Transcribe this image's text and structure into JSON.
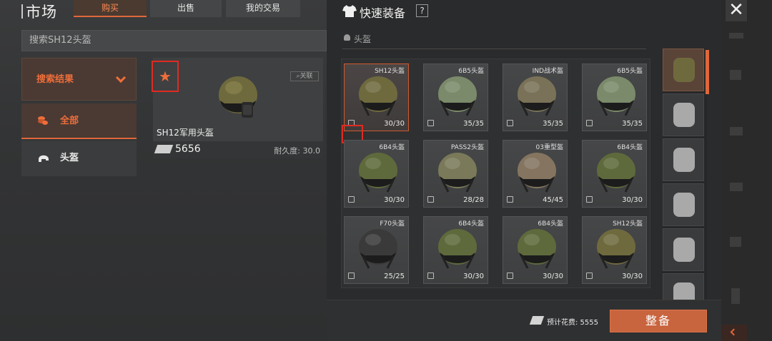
{
  "market": {
    "title": "市场",
    "tabs": [
      {
        "label": "购买",
        "active": true
      },
      {
        "label": "出售",
        "active": false
      },
      {
        "label": "我的交易",
        "active": false
      }
    ],
    "search_placeholder": "搜索SH12头盔",
    "filters": [
      {
        "label": "搜索结果",
        "icon": "chevron-down-icon",
        "selected": true
      },
      {
        "label": "全部",
        "icon": "coins-icon",
        "selected": true
      },
      {
        "label": "头盔",
        "icon": "helmet-icon",
        "selected": false
      }
    ],
    "result": {
      "name": "SH12军用头盔",
      "price": "5656",
      "durability": "耐久度: 30.0",
      "compare_label": "关联",
      "favorited": true
    }
  },
  "quick_equip": {
    "title": "快速装备",
    "help_label": "?",
    "section_label": "头盔",
    "items": [
      {
        "name": "SH12头盔",
        "count": "30/30",
        "color": "#6f6a3e",
        "selected": true
      },
      {
        "name": "6B5头盔",
        "count": "35/35",
        "color": "#7a8a6a",
        "selected": false
      },
      {
        "name": "IND战术盔",
        "count": "35/35",
        "color": "#7a7258",
        "selected": false
      },
      {
        "name": "6B5头盔",
        "count": "35/35",
        "color": "#7a8a6a",
        "selected": false
      },
      {
        "name": "6B4头盔",
        "count": "30/30",
        "color": "#5f6a3c",
        "selected": false
      },
      {
        "name": "PASS2头盔",
        "count": "28/28",
        "color": "#7a7a5a",
        "selected": false
      },
      {
        "name": "03重型盔",
        "count": "45/45",
        "color": "#857560",
        "selected": false
      },
      {
        "name": "6B4头盔",
        "count": "30/30",
        "color": "#5f6a3c",
        "selected": false
      },
      {
        "name": "F70头盔",
        "count": "25/25",
        "color": "#3a3a3a",
        "selected": false
      },
      {
        "name": "6B4头盔",
        "count": "30/30",
        "color": "#5f6a3c",
        "selected": false
      },
      {
        "name": "6B4头盔",
        "count": "30/30",
        "color": "#5f6a3c",
        "selected": false
      },
      {
        "name": "SH12头盔",
        "count": "30/30",
        "color": "#6f6a3e",
        "selected": false
      }
    ],
    "categories": [
      {
        "icon": "helmet-icon",
        "selected": true
      },
      {
        "icon": "armband-icon",
        "selected": false
      },
      {
        "icon": "gas-mask-icon",
        "selected": false
      },
      {
        "icon": "body-armor-icon",
        "selected": false
      },
      {
        "icon": "chest-rig-icon",
        "selected": false
      },
      {
        "icon": "headset-icon",
        "selected": false
      }
    ],
    "estimated_cost": "预计花费: 5555",
    "equip_button": "整备"
  },
  "window": {
    "close_label": "✕"
  },
  "colors": {
    "accent": "#e0673a",
    "highlight_box": "#e02a22",
    "equip_button": "#c8643e"
  }
}
